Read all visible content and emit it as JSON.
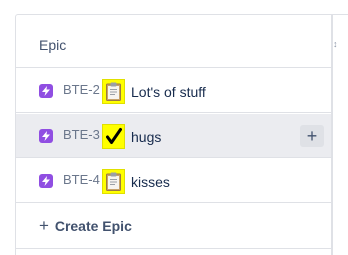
{
  "header": {
    "title": "Epic"
  },
  "epics": [
    {
      "key": "BTE-2",
      "emoji": "clipboard-emoji",
      "summary": "Lot's of stuff"
    },
    {
      "key": "BTE-3",
      "emoji": "check-mark-emoji",
      "summary": "hugs"
    },
    {
      "key": "BTE-4",
      "emoji": "clipboard-emoji",
      "summary": "kisses"
    }
  ],
  "actions": {
    "create_label": "Create Epic",
    "add_label": "+"
  },
  "colors": {
    "epic_icon": "#904ee2",
    "emoji_highlight": "#ffff00",
    "hover_row": "#ebecf0"
  }
}
